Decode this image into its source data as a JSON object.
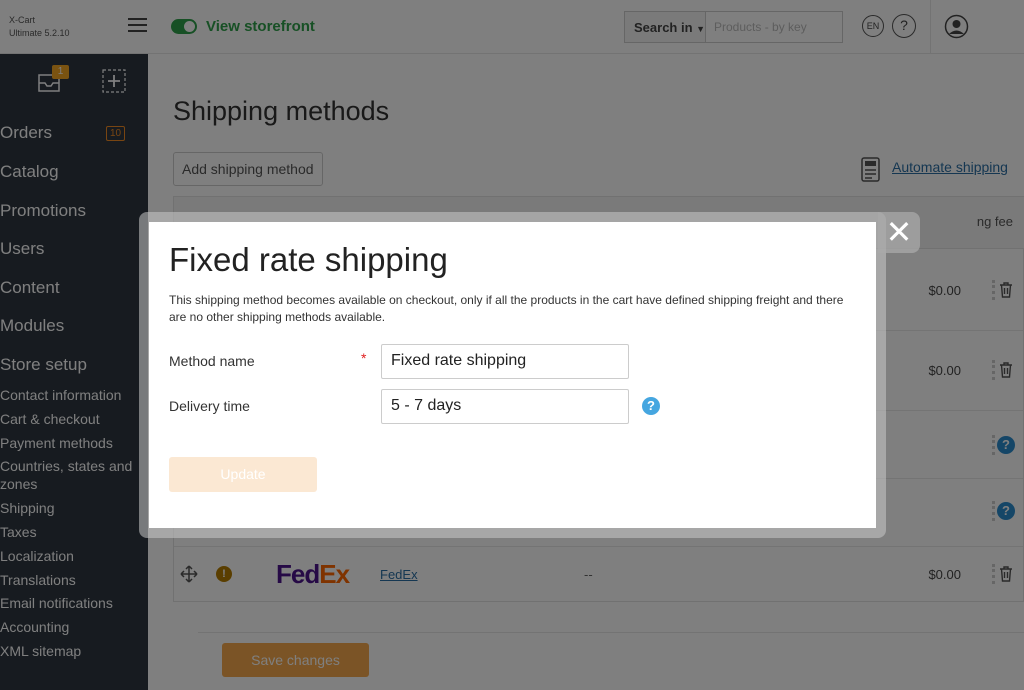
{
  "header": {
    "brand_name": "X-Cart",
    "brand_version": "Ultimate 5.2.10",
    "storefront_label": "View storefront",
    "search_in_label": "Search in",
    "search_placeholder": "Products - by key",
    "language": "EN",
    "help": "?"
  },
  "sidebar": {
    "notifications_count": "1",
    "menu": [
      {
        "label": "Orders",
        "badge": "10"
      },
      {
        "label": "Catalog"
      },
      {
        "label": "Promotions"
      },
      {
        "label": "Users"
      },
      {
        "label": "Content"
      },
      {
        "label": "Modules"
      },
      {
        "label": "Store setup"
      }
    ],
    "submenu": [
      "Contact information",
      "Cart & checkout",
      "Payment methods",
      "Countries, states and zones",
      "Shipping",
      "Taxes",
      "Localization",
      "Translations",
      "Email notifications",
      "Accounting",
      "XML sitemap"
    ]
  },
  "main": {
    "title": "Shipping methods",
    "add_button": "Add shipping method",
    "automate_link": "Automate shipping",
    "table": {
      "fee_header": "ng fee",
      "rows": [
        {
          "fee": "$0.00"
        },
        {
          "fee": "$0.00"
        },
        {
          "fee": ""
        },
        {
          "fee": ""
        },
        {
          "fee": "$0.00",
          "carrier_logo_fed": "Fed",
          "carrier_logo_ex": "Ex",
          "carrier_link": "FedEx",
          "dash": "--"
        }
      ]
    },
    "save_button": "Save changes"
  },
  "modal": {
    "close": "✕",
    "title": "Fixed rate shipping",
    "description": "This shipping method becomes available on checkout, only if all the products in the cart have defined shipping freight and there are no other shipping methods available.",
    "method_name_label": "Method name",
    "required_mark": "*",
    "method_name_value": "Fixed rate shipping",
    "delivery_time_label": "Delivery time",
    "delivery_time_value": "5 - 7 days",
    "help": "?",
    "update_button": "Update"
  },
  "colors": {
    "sidebar_bg": "#2e3740",
    "storefront_green": "#2fa14a",
    "link_blue": "#2b6ea4",
    "primary_orange": "#f6a94d",
    "help_blue": "#45a6e0"
  }
}
